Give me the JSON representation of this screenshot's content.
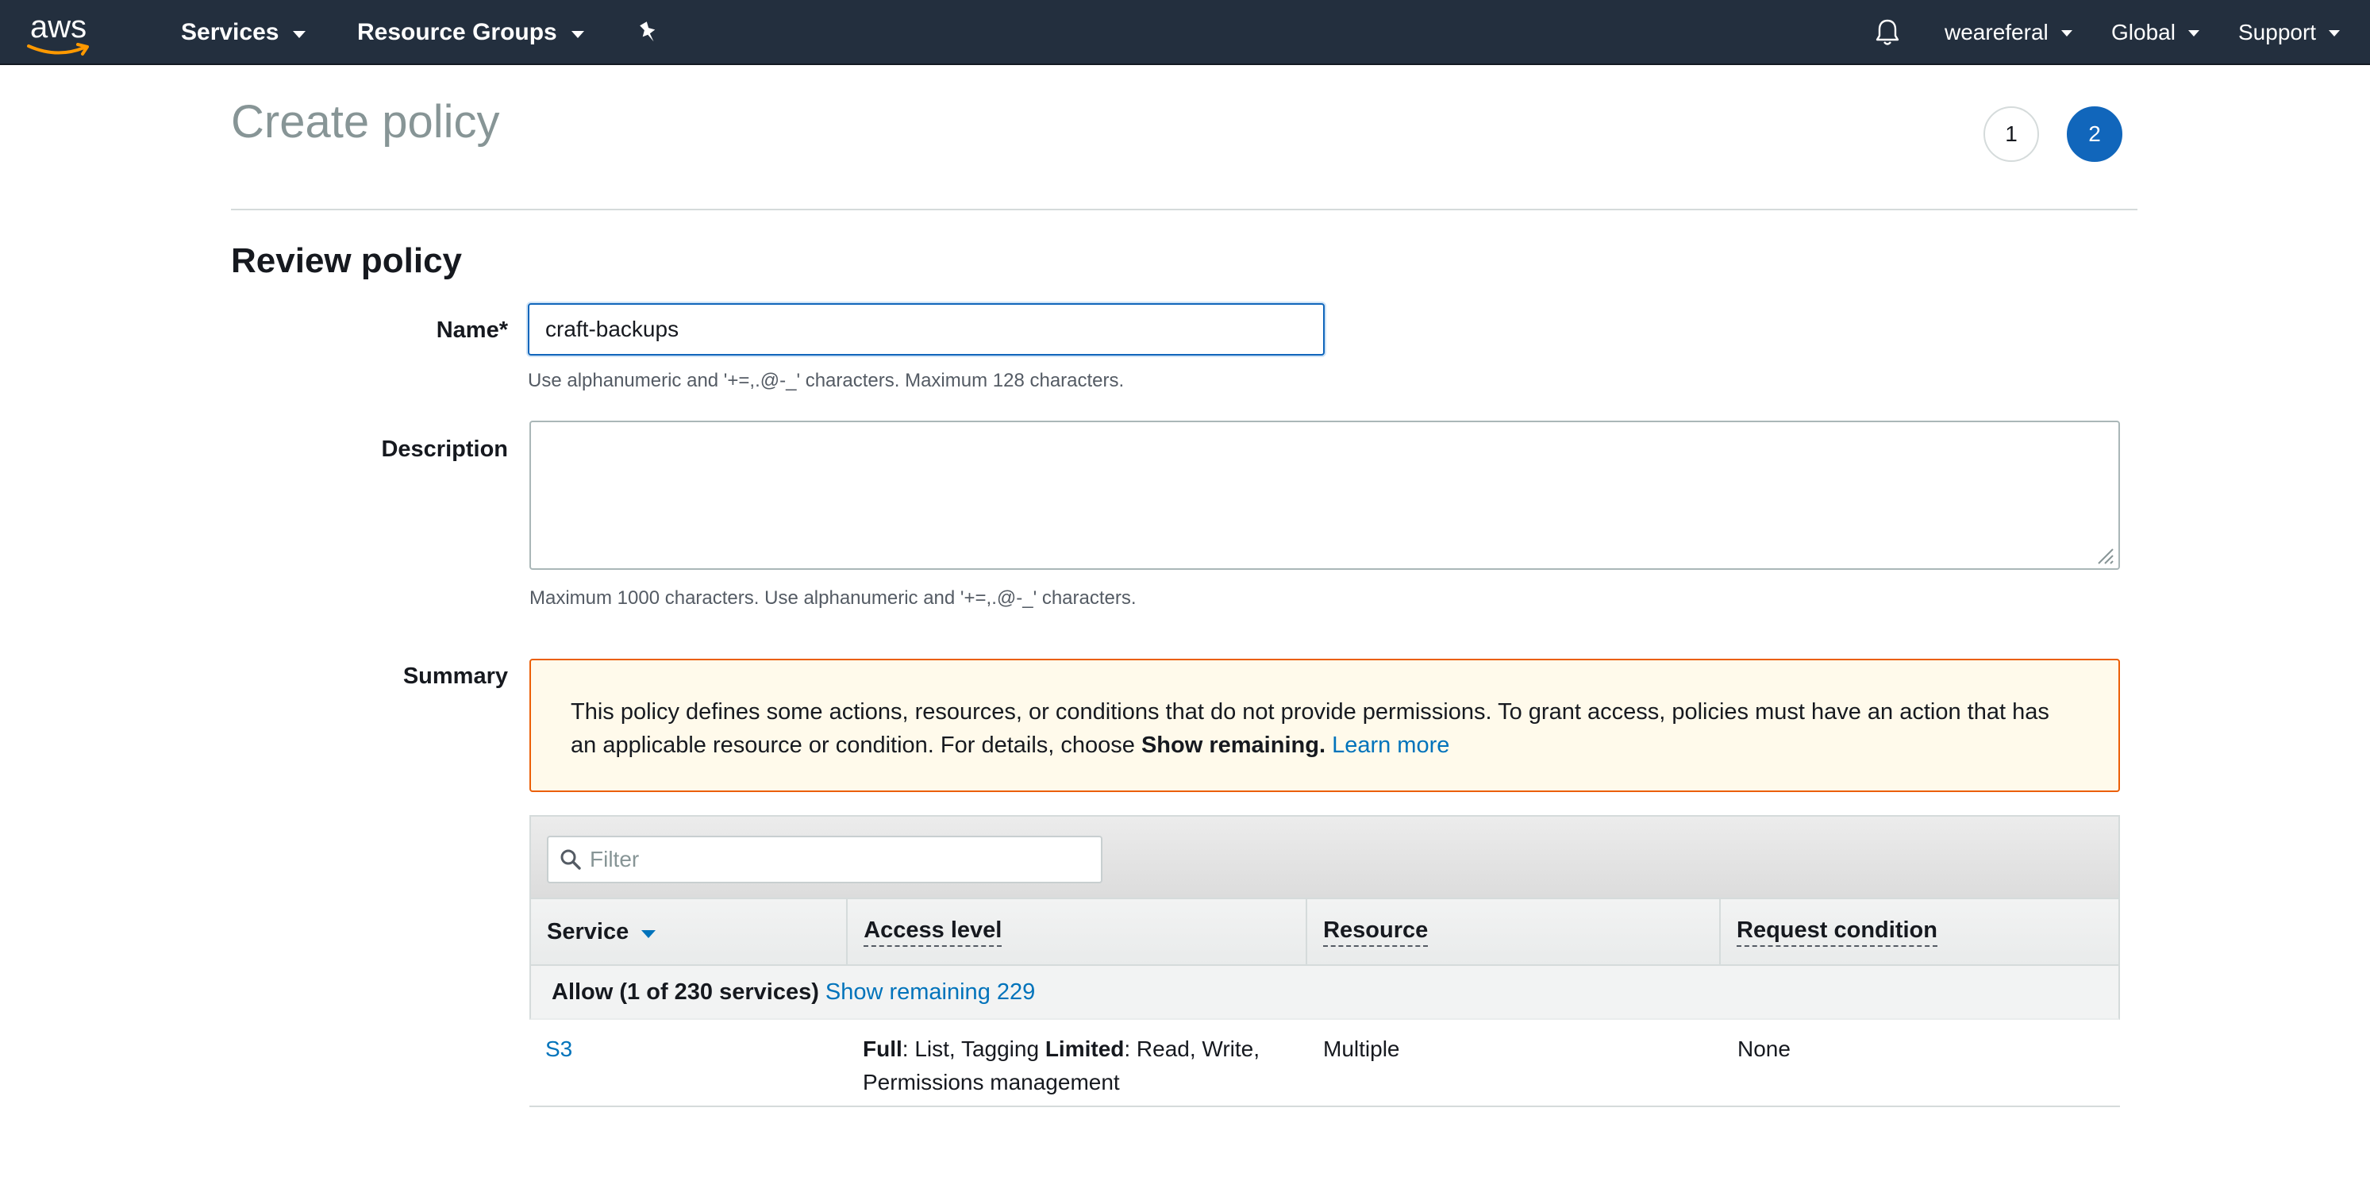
{
  "nav": {
    "logo_text": "aws",
    "services_label": "Services",
    "resource_groups_label": "Resource Groups",
    "pin_icon": "pushpin-icon",
    "bell_icon": "bell-icon",
    "account_label": "weareferal",
    "region_label": "Global",
    "support_label": "Support"
  },
  "header": {
    "title": "Create policy",
    "steps": [
      "1",
      "2"
    ],
    "active_step": "2"
  },
  "review": {
    "section_title": "Review policy",
    "name_label": "Name*",
    "name_value": "craft-backups",
    "name_hint": "Use alphanumeric and '+=,.@-_' characters. Maximum 128 characters.",
    "description_label": "Description",
    "description_value": "",
    "description_hint": "Maximum 1000 characters. Use alphanumeric and '+=,.@-_' characters.",
    "summary_label": "Summary"
  },
  "warning": {
    "text_1": "This policy defines some actions, resources, or conditions that do not provide permissions. To grant access, policies must have an action that has an applicable resource or condition. For details, choose ",
    "bold": "Show remaining.",
    "link": "Learn more"
  },
  "table": {
    "filter_placeholder": "Filter",
    "columns": [
      "Service",
      "Access level",
      "Resource",
      "Request condition"
    ],
    "group_label": "Allow (1 of 230 services)",
    "group_link": "Show remaining 229",
    "rows": [
      {
        "service": "S3",
        "access_full_label": "Full",
        "access_full_value": ": List, Tagging ",
        "access_limited_label": "Limited",
        "access_limited_value": ": Read, Write, Permissions management",
        "resource": "Multiple",
        "condition": "None"
      }
    ]
  },
  "colors": {
    "nav_bg": "#232f3e",
    "accent": "#1166bb",
    "link": "#0073bb",
    "warning_border": "#eb5f07",
    "warning_bg": "#fffaeb"
  }
}
